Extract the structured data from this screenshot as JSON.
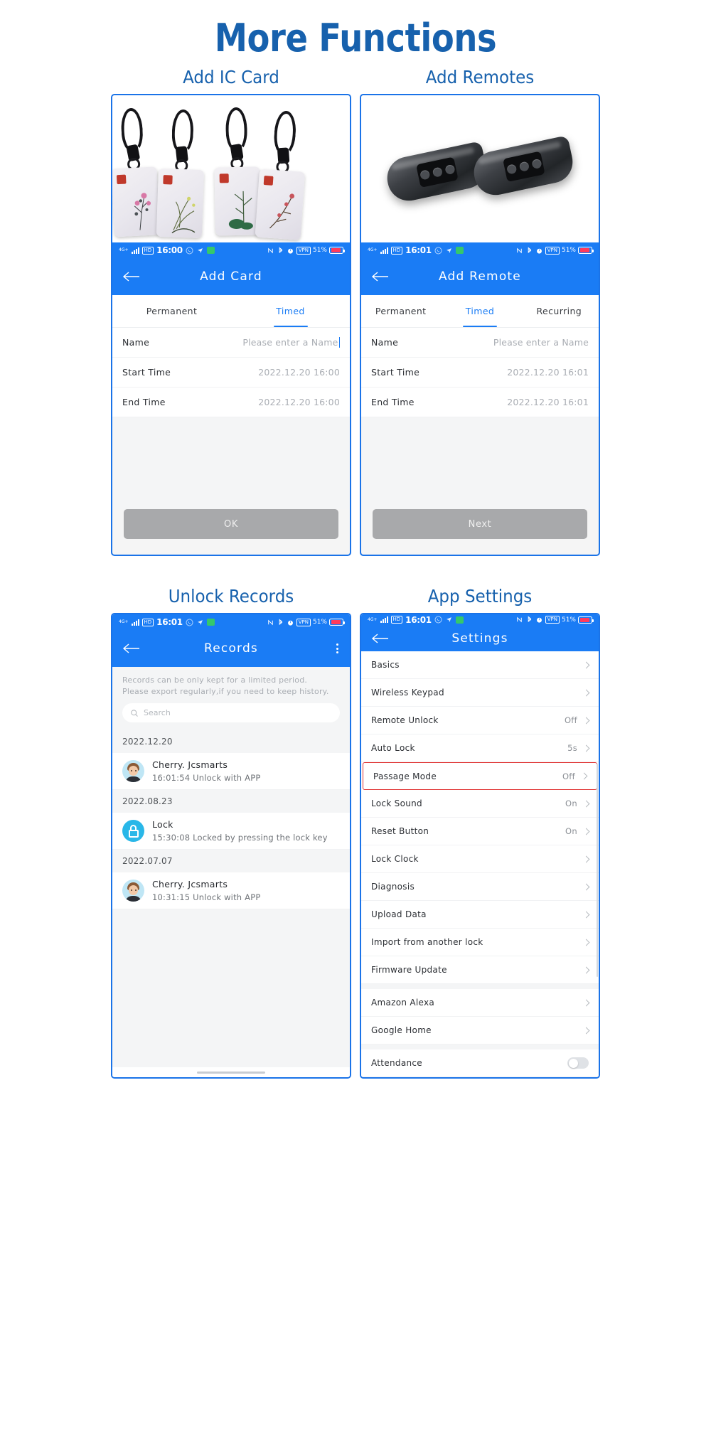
{
  "page": {
    "title": "More Functions",
    "accent": "#1761ad",
    "app_blue": "#1a7cf5"
  },
  "panels": [
    {
      "caption": "Add IC Card",
      "status": {
        "network": "4G+",
        "hd": "HD",
        "time": "16:00",
        "battery": "51%"
      },
      "header": {
        "title": "Add Card"
      },
      "tabs": [
        {
          "label": "Permanent",
          "active": false
        },
        {
          "label": "Timed",
          "active": true
        }
      ],
      "rows": [
        {
          "label": "Name",
          "value": "Please enter a Name",
          "cursor": true
        },
        {
          "label": "Start Time",
          "value": "2022.12.20  16:00"
        },
        {
          "label": "End Time",
          "value": "2022.12.20  16:00"
        }
      ],
      "button": "OK"
    },
    {
      "caption": "Add Remotes",
      "status": {
        "network": "4G+",
        "hd": "HD",
        "time": "16:01",
        "battery": "51%"
      },
      "header": {
        "title": "Add Remote"
      },
      "tabs": [
        {
          "label": "Permanent",
          "active": false
        },
        {
          "label": "Timed",
          "active": true
        },
        {
          "label": "Recurring",
          "active": false
        }
      ],
      "rows": [
        {
          "label": "Name",
          "value": "Please enter a Name"
        },
        {
          "label": "Start Time",
          "value": "2022.12.20  16:01"
        },
        {
          "label": "End Time",
          "value": "2022.12.20  16:01"
        }
      ],
      "button": "Next"
    },
    {
      "caption": "Unlock Records",
      "status": {
        "network": "4G+",
        "hd": "HD",
        "time": "16:01",
        "battery": "51%"
      },
      "header": {
        "title": "Records"
      },
      "notice_line1": "Records can be only kept for a limited period.",
      "notice_line2": "Please export regularly,if you need to keep history.",
      "search_placeholder": "Search",
      "groups": [
        {
          "date": "2022.12.20",
          "items": [
            {
              "icon": "avatar",
              "name": "Cherry. Jcsmarts",
              "detail": "16:01:54 Unlock with APP"
            }
          ]
        },
        {
          "date": "2022.08.23",
          "items": [
            {
              "icon": "lock",
              "name": "Lock",
              "detail": "15:30:08 Locked by pressing the lock key"
            }
          ]
        },
        {
          "date": "2022.07.07",
          "items": [
            {
              "icon": "avatar",
              "name": "Cherry. Jcsmarts",
              "detail": "10:31:15 Unlock with APP"
            }
          ]
        }
      ]
    },
    {
      "caption": "App Settings",
      "status": {
        "network": "4G+",
        "hd": "HD",
        "time": "16:01",
        "battery": "51%"
      },
      "header": {
        "title": "Settings"
      },
      "settings": [
        {
          "label": "Basics",
          "value": "",
          "chevron": true
        },
        {
          "label": "Wireless Keypad",
          "value": "",
          "chevron": true
        },
        {
          "label": "Remote Unlock",
          "value": "Off",
          "chevron": true
        },
        {
          "label": "Auto Lock",
          "value": "5s",
          "chevron": true
        },
        {
          "label": "Passage Mode",
          "value": "Off",
          "chevron": true,
          "highlight": true
        },
        {
          "label": "Lock Sound",
          "value": "On",
          "chevron": true
        },
        {
          "label": "Reset Button",
          "value": "On",
          "chevron": true
        },
        {
          "label": "Lock Clock",
          "value": "",
          "chevron": true
        },
        {
          "label": "Diagnosis",
          "value": "",
          "chevron": true
        },
        {
          "label": "Upload Data",
          "value": "",
          "chevron": true
        },
        {
          "label": "Import from another lock",
          "value": "",
          "chevron": true
        },
        {
          "label": "Firmware Update",
          "value": "",
          "chevron": true,
          "gap_after": true
        },
        {
          "label": "Amazon Alexa",
          "value": "",
          "chevron": true
        },
        {
          "label": "Google Home",
          "value": "",
          "chevron": true,
          "gap_after": true
        },
        {
          "label": "Attendance",
          "value": "",
          "toggle": true,
          "toggle_on": false
        }
      ],
      "highlight_color": "#e03131"
    }
  ]
}
